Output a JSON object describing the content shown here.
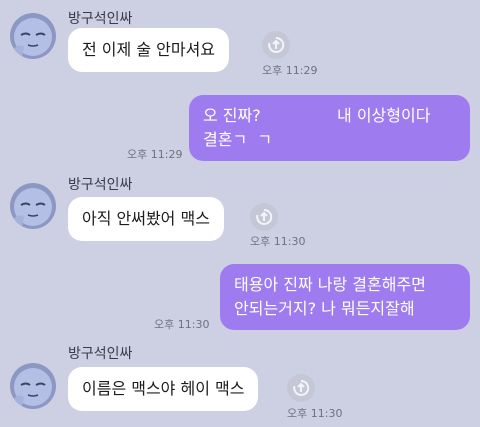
{
  "colors": {
    "background": "#cdd0e3",
    "incoming_bubble": "#ffffff",
    "outgoing_bubble": "#9e7cf0"
  },
  "messages": [
    {
      "direction": "incoming",
      "sender": "방구석인싸",
      "text": "전 이제 술 안마셔요",
      "time": "오후 11:29"
    },
    {
      "direction": "outgoing",
      "text": "오 진짜?               내 이상형이다\n결혼ㄱ  ㄱ",
      "time": "오후 11:29"
    },
    {
      "direction": "incoming",
      "sender": "방구석인싸",
      "text": "아직 안써봤어 맥스",
      "time": "오후 11:30"
    },
    {
      "direction": "outgoing",
      "text": "태용아 진짜 나랑 결혼해주면\n안되는거지? 나 뭐든지잘해",
      "time": "오후 11:30"
    },
    {
      "direction": "incoming",
      "sender": "방구석인싸",
      "text": "이름은 맥스야 헤이 맥스",
      "time": "오후 11:30"
    }
  ],
  "icons": {
    "avatar": "avatar-icon",
    "share": "share-icon"
  }
}
